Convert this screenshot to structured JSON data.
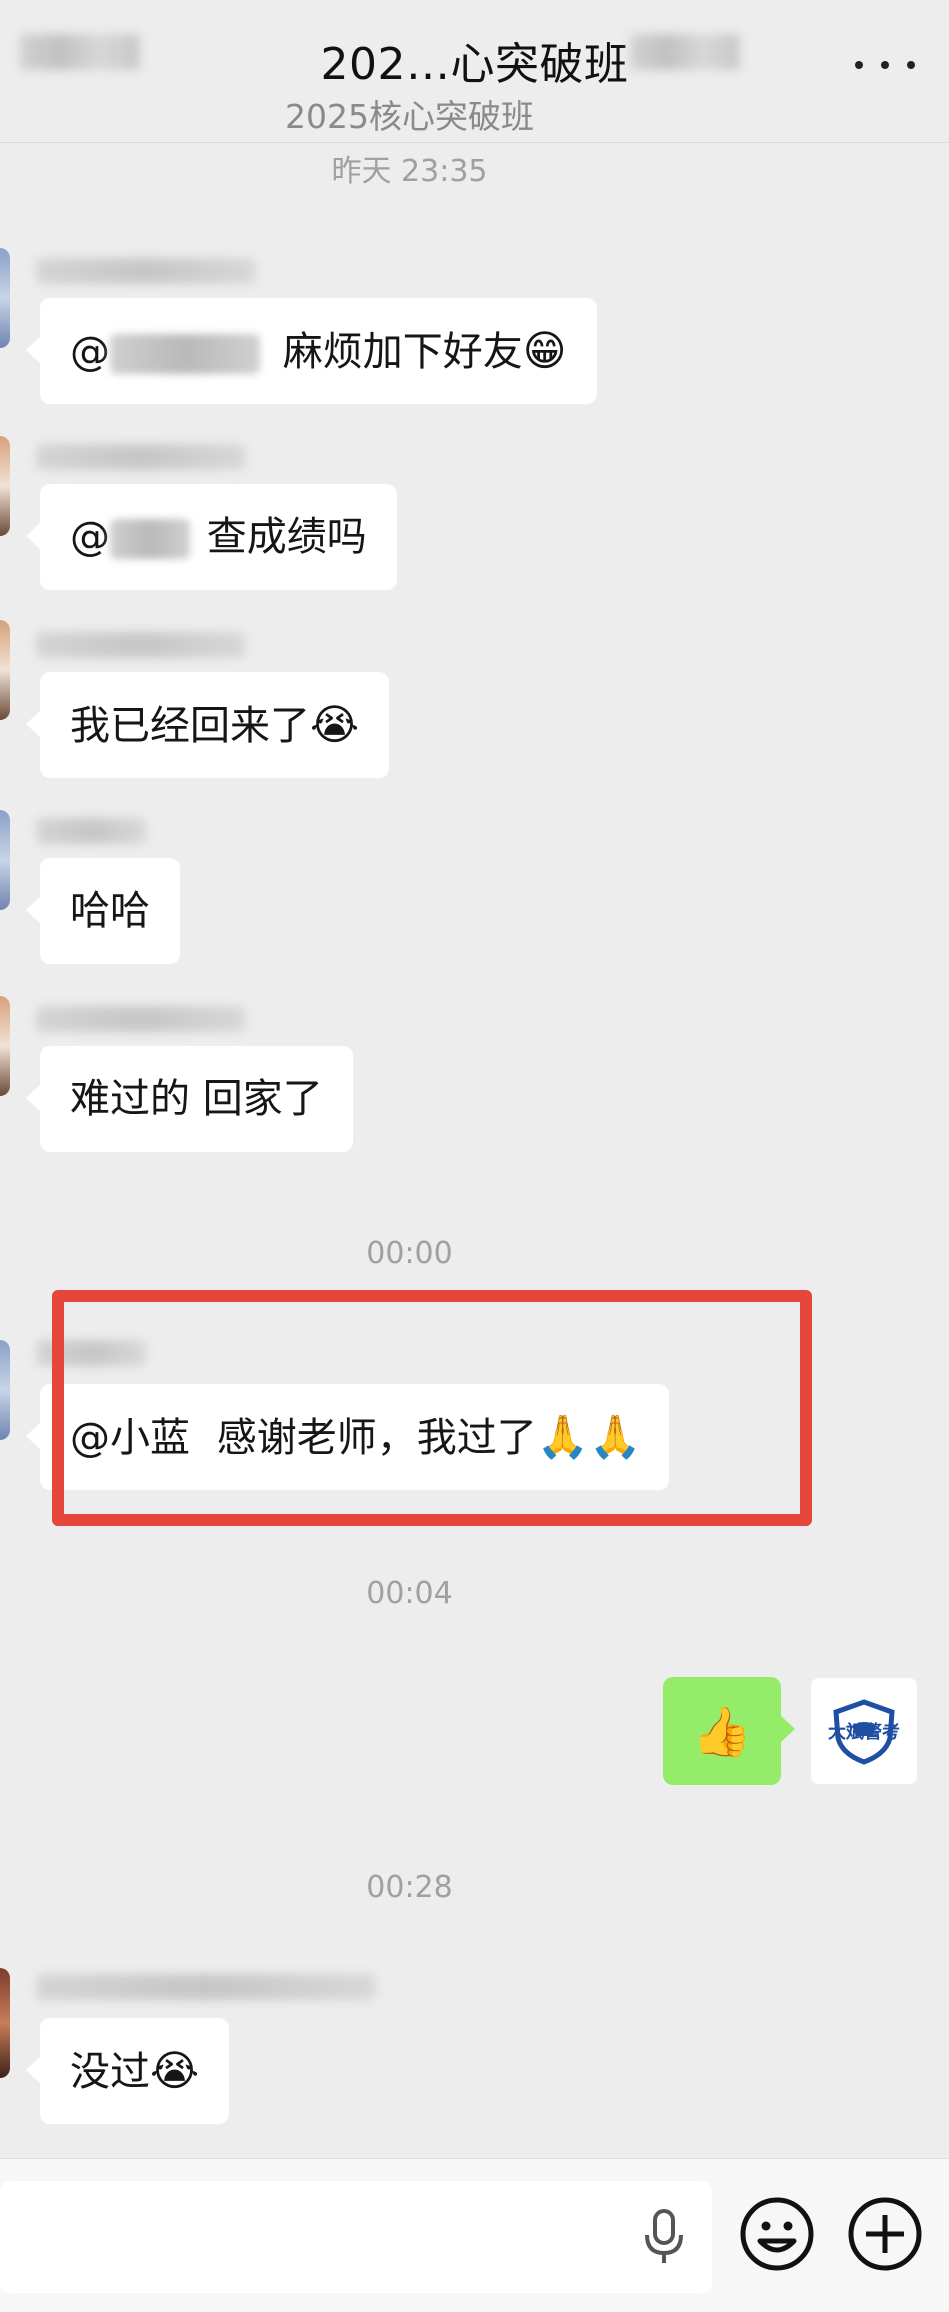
{
  "header": {
    "title": "202…心突破班",
    "subtitle": "2025核心突破班",
    "more_icon": "more-dots-icon"
  },
  "timestamps": [
    "昨天 23:35",
    "00:00",
    "00:04",
    "00:28"
  ],
  "messages": [
    {
      "mention": "@",
      "text": "麻烦加下好友",
      "emoji": "😁"
    },
    {
      "mention": "@",
      "text": "查成绩吗",
      "emoji": ""
    },
    {
      "mention": "",
      "text": "我已经回来了",
      "emoji": "😭"
    },
    {
      "mention": "",
      "text": "哈哈",
      "emoji": ""
    },
    {
      "mention": "",
      "text": "难过的 回家了",
      "emoji": ""
    },
    {
      "mention": "@小蓝",
      "text": "感谢老师，我过了",
      "emoji": "🙏🙏"
    },
    {
      "mention": "",
      "text": "没过",
      "emoji": "😭"
    }
  ],
  "my_message": {
    "emoji": "👍"
  },
  "my_avatar": {
    "logo_text": "大斌警考",
    "brand_color": "#1f4fa3"
  },
  "highlight": {
    "color": "#e5463c"
  },
  "input_bar": {
    "mic_icon": "microphone-icon",
    "emoji_icon": "smiley-icon",
    "add_icon": "plus-circle-icon"
  }
}
